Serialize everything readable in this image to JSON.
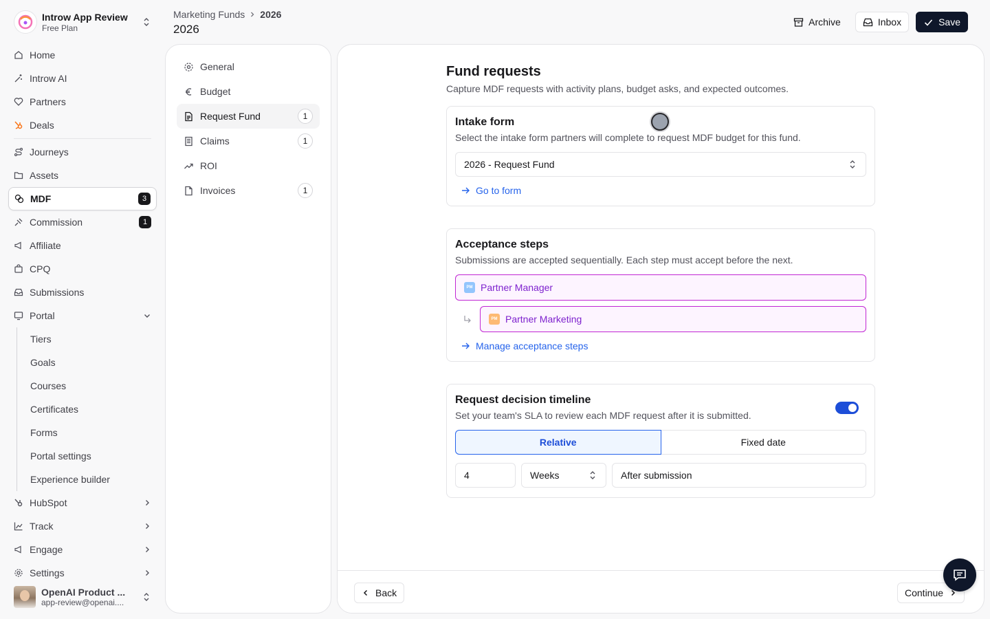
{
  "workspace": {
    "name": "Introw App Review",
    "plan": "Free Plan"
  },
  "nav": {
    "home": "Home",
    "ai": "Introw AI",
    "partners": "Partners",
    "deals": "Deals",
    "journeys": "Journeys",
    "assets": "Assets",
    "mdf": "MDF",
    "mdf_badge": "3",
    "commission": "Commission",
    "commission_badge": "1",
    "affiliate": "Affiliate",
    "cpq": "CPQ",
    "submissions": "Submissions",
    "portal": "Portal",
    "portal_sub": [
      "Tiers",
      "Goals",
      "Courses",
      "Certificates",
      "Forms",
      "Portal settings",
      "Experience builder"
    ],
    "hubspot": "HubSpot",
    "track": "Track",
    "engage": "Engage",
    "settings": "Settings"
  },
  "user": {
    "name": "OpenAI Product ...",
    "email": "app-review@openai...."
  },
  "header": {
    "breadcrumb_parent": "Marketing Funds",
    "breadcrumb_current": "2026",
    "title": "2026",
    "archive": "Archive",
    "inbox": "Inbox",
    "save": "Save"
  },
  "subnav": [
    {
      "label": "General",
      "count": ""
    },
    {
      "label": "Budget",
      "count": ""
    },
    {
      "label": "Request Fund",
      "count": "1"
    },
    {
      "label": "Claims",
      "count": "1"
    },
    {
      "label": "ROI",
      "count": ""
    },
    {
      "label": "Invoices",
      "count": "1"
    }
  ],
  "main": {
    "title": "Fund requests",
    "description": "Capture MDF requests with activity plans, budget asks, and expected outcomes.",
    "intake": {
      "title": "Intake form",
      "description": "Select the intake form partners will complete to request MDF budget for this fund.",
      "selected": "2026 - Request Fund",
      "link": "Go to form"
    },
    "acceptance": {
      "title": "Acceptance steps",
      "description": "Submissions are accepted sequentially. Each step must accept before the next.",
      "steps": [
        {
          "tag": "PM",
          "label": "Partner Manager",
          "color": "#93c5fd"
        },
        {
          "tag": "PM",
          "label": "Partner Marketing",
          "color": "#fdba74"
        }
      ],
      "link": "Manage acceptance steps"
    },
    "timeline": {
      "title": "Request decision timeline",
      "description": "Set your team's SLA to review each MDF request after it is submitted.",
      "enabled": true,
      "mode_relative": "Relative",
      "mode_fixed": "Fixed date",
      "amount": "4",
      "unit": "Weeks",
      "anchor": "After submission"
    },
    "footer": {
      "back": "Back",
      "continue": "Continue"
    }
  },
  "colors": {
    "accent": "#2563eb",
    "dark": "#0f172a",
    "step_border": "#c026d3"
  }
}
